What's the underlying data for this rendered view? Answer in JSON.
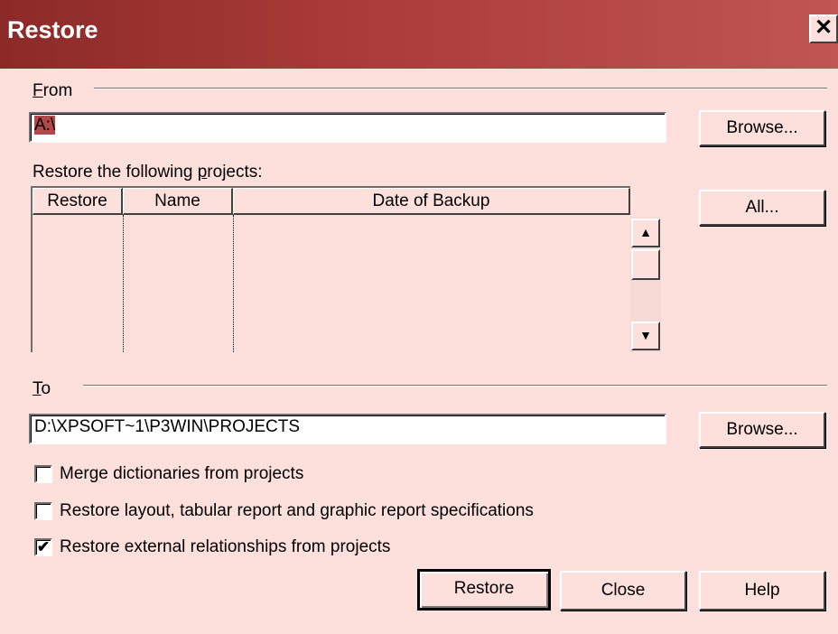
{
  "window": {
    "title": "Restore",
    "close_glyph": "✕"
  },
  "from": {
    "group_mnemonic": "F",
    "group_rest": "rom",
    "path_value": "A:\\",
    "browse_label": "Browse..."
  },
  "projects": {
    "label_pre": "Restore the following ",
    "label_mnemonic": "p",
    "label_post": "rojects:",
    "columns": [
      "Restore",
      "Name",
      "Date of Backup"
    ],
    "rows": [],
    "all_label": "All...",
    "scroll_up_glyph": "▲",
    "scroll_down_glyph": "▼"
  },
  "to": {
    "group_mnemonic": "T",
    "group_rest": "o",
    "path_value": "D:\\XPSOFT~1\\P3WIN\\PROJECTS",
    "browse_label": "Browse..."
  },
  "options": [
    {
      "label": "Merge dictionaries from projects",
      "checked": false
    },
    {
      "label": "Restore layout, tabular report and graphic report specifications",
      "checked": false
    },
    {
      "label": "Restore external relationships from projects",
      "checked": true
    }
  ],
  "check_glyph": "✔",
  "buttons": {
    "restore": "Restore",
    "close": "Close",
    "help": "Help"
  }
}
